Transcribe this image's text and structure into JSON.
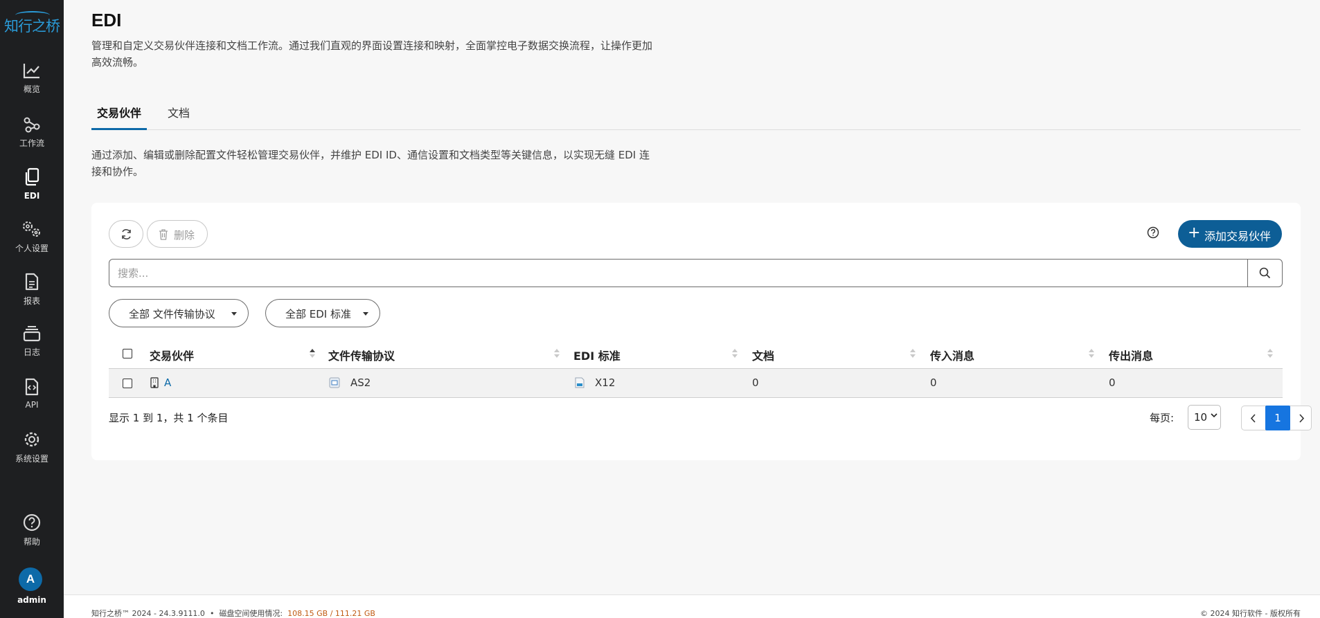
{
  "sidebar": {
    "logo": "知行之桥",
    "items": [
      {
        "label": "概览",
        "icon": "chart-line-icon"
      },
      {
        "label": "工作流",
        "icon": "share-nodes-icon"
      },
      {
        "label": "EDI",
        "icon": "documents-icon"
      },
      {
        "label": "个人设置",
        "icon": "gears-icon"
      },
      {
        "label": "报表",
        "icon": "report-icon"
      },
      {
        "label": "日志",
        "icon": "layers-icon"
      },
      {
        "label": "API",
        "icon": "code-file-icon"
      },
      {
        "label": "系统设置",
        "icon": "gear-icon"
      }
    ],
    "help": "帮助",
    "avatar_initial": "A",
    "username": "admin"
  },
  "page": {
    "title": "EDI",
    "description": "管理和自定义交易伙伴连接和文档工作流。通过我们直观的界面设置连接和映射，全面掌控电子数据交换流程，让操作更加高效流畅。"
  },
  "tabs": [
    {
      "label": "交易伙伴",
      "active": true
    },
    {
      "label": "文档",
      "active": false
    }
  ],
  "section_description": "通过添加、编辑或删除配置文件轻松管理交易伙伴，并维护 EDI ID、通信设置和文档类型等关键信息，以实现无缝 EDI 连接和协作。",
  "toolbar": {
    "delete_label": "删除",
    "add_label": "添加交易伙伴"
  },
  "search": {
    "placeholder": "搜索..."
  },
  "filters": [
    {
      "label": "全部 文件传输协议"
    },
    {
      "label": "全部 EDI 标准"
    }
  ],
  "table": {
    "columns": [
      "交易伙伴",
      "文件传输协议",
      "EDI 标准",
      "文档",
      "传入消息",
      "传出消息"
    ],
    "rows": [
      {
        "partner": "A",
        "protocol": "AS2",
        "standard": "X12",
        "documents": "0",
        "incoming": "0",
        "outgoing": "0"
      }
    ]
  },
  "pagination": {
    "info": "显示 1 到 1，共 1 个条目",
    "per_page_label": "每页:",
    "per_page_value": "10",
    "current_page": "1"
  },
  "footer": {
    "version": "知行之桥™ 2024 - 24.3.9111.0",
    "separator": "•",
    "disk_label": "磁盘空间使用情况:",
    "disk_value": "108.15 GB / 111.21 GB",
    "copyright": "© 2024 知行软件 - 版权所有"
  },
  "colors": {
    "sidebar_bg": "#1e1f21",
    "accent": "#0d5e96",
    "link": "#0d6aa8",
    "page_active": "#1675e0",
    "disk_warning": "#c05a12"
  }
}
